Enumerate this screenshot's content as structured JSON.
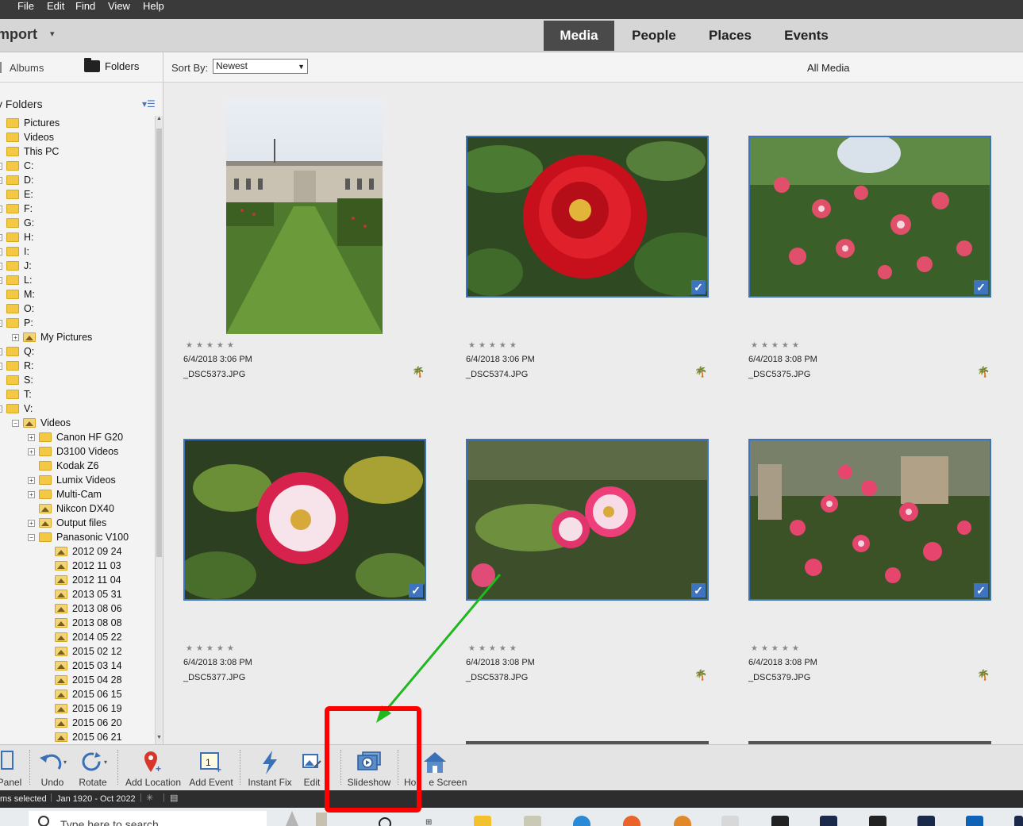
{
  "menubar": {
    "items": [
      "File",
      "Edit",
      "Find",
      "View",
      "Help"
    ]
  },
  "topnav": {
    "import_label": "mport",
    "tabs": [
      "Media",
      "People",
      "Places",
      "Events"
    ],
    "active_tab": "Media"
  },
  "subbar": {
    "albums_label": "Albums",
    "folders_label": "Folders",
    "sort_label": "Sort By:",
    "sort_value": "Newest",
    "view_label": "All Media"
  },
  "leftpanel": {
    "title": "y Folders",
    "tree": [
      {
        "label": "Pictures"
      },
      {
        "label": "Videos"
      },
      {
        "label": "This PC"
      },
      {
        "label": "C:"
      },
      {
        "label": "D:"
      },
      {
        "label": "E:"
      },
      {
        "label": "F:"
      },
      {
        "label": "G:"
      },
      {
        "label": "H:"
      },
      {
        "label": "I:"
      },
      {
        "label": "J:"
      },
      {
        "label": "L:"
      },
      {
        "label": "M:"
      },
      {
        "label": "O:"
      },
      {
        "label": "P:"
      },
      {
        "label": "My Pictures"
      },
      {
        "label": "Q:"
      },
      {
        "label": "R:"
      },
      {
        "label": "S:"
      },
      {
        "label": "T:"
      },
      {
        "label": "V:"
      },
      {
        "label": "Videos"
      },
      {
        "label": "Canon HF G20"
      },
      {
        "label": "D3100 Videos"
      },
      {
        "label": "Kodak Z6"
      },
      {
        "label": "Lumix Videos"
      },
      {
        "label": "Multi-Cam"
      },
      {
        "label": "Nikcon DX40"
      },
      {
        "label": "Output files"
      },
      {
        "label": "Panasonic V100"
      },
      {
        "label": "2012 09 24"
      },
      {
        "label": "2012 11 03"
      },
      {
        "label": "2012 11 04"
      },
      {
        "label": "2013 05 31"
      },
      {
        "label": "2013 08 06"
      },
      {
        "label": "2013 08 08"
      },
      {
        "label": "2014 05 22"
      },
      {
        "label": "2015 02 12"
      },
      {
        "label": "2015 03 14"
      },
      {
        "label": "2015 04 28"
      },
      {
        "label": "2015 06 15"
      },
      {
        "label": "2015 06 19"
      },
      {
        "label": "2015 06 20"
      },
      {
        "label": "2015 06 21"
      }
    ]
  },
  "photos": [
    {
      "stars": "★★★★★",
      "date": "6/4/2018 3:06 PM",
      "filename": "_DSC5373.JPG",
      "selected": false
    },
    {
      "stars": "★★★★★",
      "date": "6/4/2018 3:06 PM",
      "filename": "_DSC5374.JPG",
      "selected": true
    },
    {
      "stars": "★★★★★",
      "date": "6/4/2018 3:08 PM",
      "filename": "_DSC5375.JPG",
      "selected": true
    },
    {
      "stars": "★★★★★",
      "date": "6/4/2018 3:08 PM",
      "filename": "_DSC5377.JPG",
      "selected": true
    },
    {
      "stars": "★★★★★",
      "date": "6/4/2018 3:08 PM",
      "filename": "_DSC5378.JPG",
      "selected": true
    },
    {
      "stars": "★★★★★",
      "date": "6/4/2018 3:08 PM",
      "filename": "_DSC5379.JPG",
      "selected": true
    }
  ],
  "toolbar": {
    "panel": "Panel",
    "undo": "Undo",
    "rotate": "Rotate",
    "add_location": "Add Location",
    "add_event": "Add Event",
    "instant_fix": "Instant Fix",
    "edit": "Edit",
    "slideshow": "Slideshow",
    "home_screen_a": "Ho",
    "home_screen_b": "e Screen"
  },
  "statusbar": {
    "selected": "ms selected",
    "date_range": "Jan 1920 - Oct 2022"
  },
  "taskbar": {
    "search_placeholder": "Type here to search"
  },
  "colors": {
    "selection_blue": "#3e73bf",
    "highlight_red": "#ff0000",
    "arrow_green": "#1fb81f"
  }
}
